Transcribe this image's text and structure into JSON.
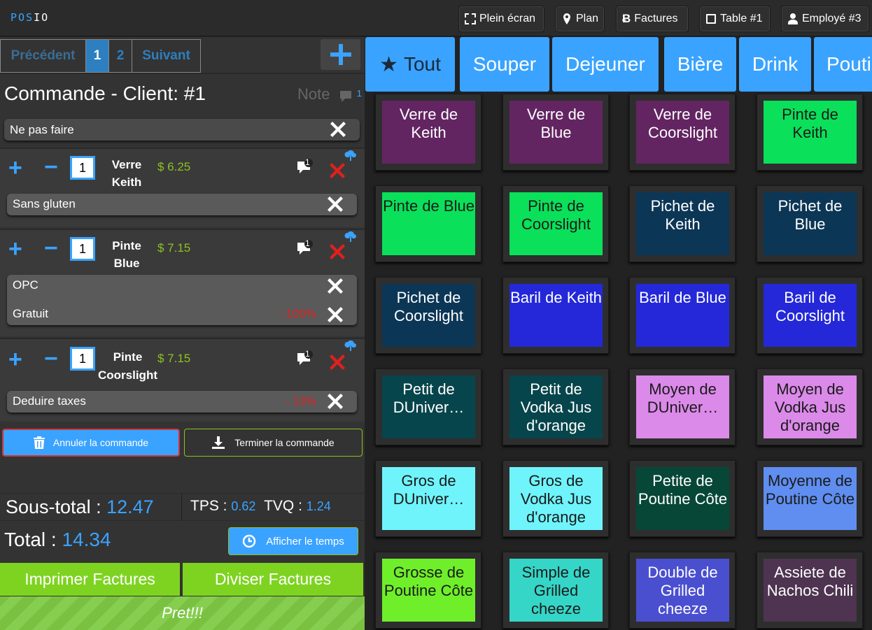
{
  "topbar": {
    "logo_a": "POS",
    "logo_b": "IO",
    "fullscreen": "Plein écran",
    "plan": "Plan",
    "invoices": "Factures",
    "table": "Table #1",
    "employee": "Employé #3"
  },
  "pager": {
    "prev": "Précédent",
    "p1": "1",
    "p2": "2",
    "next": "Suivant"
  },
  "order": {
    "title": "Commande - Client: #1",
    "note_label": "Note",
    "note_count": "1",
    "order_note": "Ne pas faire",
    "items": [
      {
        "qty": "1",
        "name1": "Verre",
        "name2": "Keith",
        "price": "$ 6.25",
        "comments": "1",
        "mods": [
          {
            "label": "Sans gluten",
            "pct": ""
          }
        ]
      },
      {
        "qty": "1",
        "name1": "Pinte",
        "name2": "Blue",
        "price": "$ 7.15",
        "comments": "1",
        "mods": [
          {
            "label": "OPC",
            "pct": ""
          },
          {
            "label": "Gratuit",
            "pct": "- 100%"
          }
        ]
      },
      {
        "qty": "1",
        "name1": "Pinte",
        "name2": "Coorslight",
        "price": "$ 7.15",
        "comments": "1",
        "mods": [
          {
            "label": "Deduire taxes",
            "pct": "- 13%"
          }
        ]
      }
    ],
    "cancel": "Annuler la commande",
    "finish": "Terminer la commande"
  },
  "totals": {
    "subtotal_label": "Sous-total :",
    "subtotal": "12.47",
    "tps_label": "TPS :",
    "tps": "0.62",
    "tvq_label": "TVQ :",
    "tvq": "1.24",
    "total_label": "Total :",
    "total": "14.34",
    "show_time": "Afficher le temps"
  },
  "actions": {
    "print": "Imprimer Factures",
    "divide": "Diviser Factures",
    "ready": "Pret!!!"
  },
  "categories": [
    "Tout",
    "Souper",
    "Dejeuner",
    "Bière",
    "Drink",
    "Pouti"
  ],
  "products": [
    {
      "label": "Verre de Keith",
      "color": "#632562",
      "text": "#ffffff"
    },
    {
      "label": "Verre de Blue",
      "color": "#632562",
      "text": "#ffffff"
    },
    {
      "label": "Verre de Coorslight",
      "color": "#632562",
      "text": "#ffffff"
    },
    {
      "label": "Pinte de Keith",
      "color": "#0ae05a",
      "text": "#1a1a1a"
    },
    {
      "label": "Pinte de Blue",
      "color": "#0ae05a",
      "text": "#1a1a1a"
    },
    {
      "label": "Pinte de Coorslight",
      "color": "#0ae05a",
      "text": "#1a1a1a"
    },
    {
      "label": "Pichet de Keith",
      "color": "#0c3656",
      "text": "#ffffff"
    },
    {
      "label": "Pichet de Blue",
      "color": "#0c3656",
      "text": "#ffffff"
    },
    {
      "label": "Pichet de Coorslight",
      "color": "#0c3656",
      "text": "#ffffff"
    },
    {
      "label": "Baril de Keith",
      "color": "#2428d8",
      "text": "#ffffff"
    },
    {
      "label": "Baril de Blue",
      "color": "#2428d8",
      "text": "#ffffff"
    },
    {
      "label": "Baril de Coorslight",
      "color": "#2428d8",
      "text": "#ffffff"
    },
    {
      "label": "Petit de DUniver…",
      "color": "#07454c",
      "text": "#ffffff"
    },
    {
      "label": "Petit de Vodka Jus d'orange",
      "color": "#07454c",
      "text": "#ffffff"
    },
    {
      "label": "Moyen de DUniver…",
      "color": "#db8ae9",
      "text": "#1a1a1a"
    },
    {
      "label": "Moyen de Vodka Jus d'orange",
      "color": "#db8ae9",
      "text": "#1a1a1a"
    },
    {
      "label": "Gros de DUniver…",
      "color": "#6ff4fc",
      "text": "#1a1a1a"
    },
    {
      "label": "Gros de Vodka Jus d'orange",
      "color": "#6ff4fc",
      "text": "#1a1a1a"
    },
    {
      "label": "Petite de Poutine Côte",
      "color": "#064738",
      "text": "#ffffff"
    },
    {
      "label": "Moyenne de Poutine Côte",
      "color": "#5f8ef0",
      "text": "#1a1a1a"
    },
    {
      "label": "Grosse de Poutine Côte",
      "color": "#6fef2a",
      "text": "#1a1a1a"
    },
    {
      "label": "Simple de Grilled cheeze",
      "color": "#35d6c8",
      "text": "#1a1a1a"
    },
    {
      "label": "Double de Grilled cheeze",
      "color": "#4a4fd0",
      "text": "#ffffff"
    },
    {
      "label": "Assiete de Nachos Chili",
      "color": "#4e3450",
      "text": "#ffffff"
    }
  ]
}
